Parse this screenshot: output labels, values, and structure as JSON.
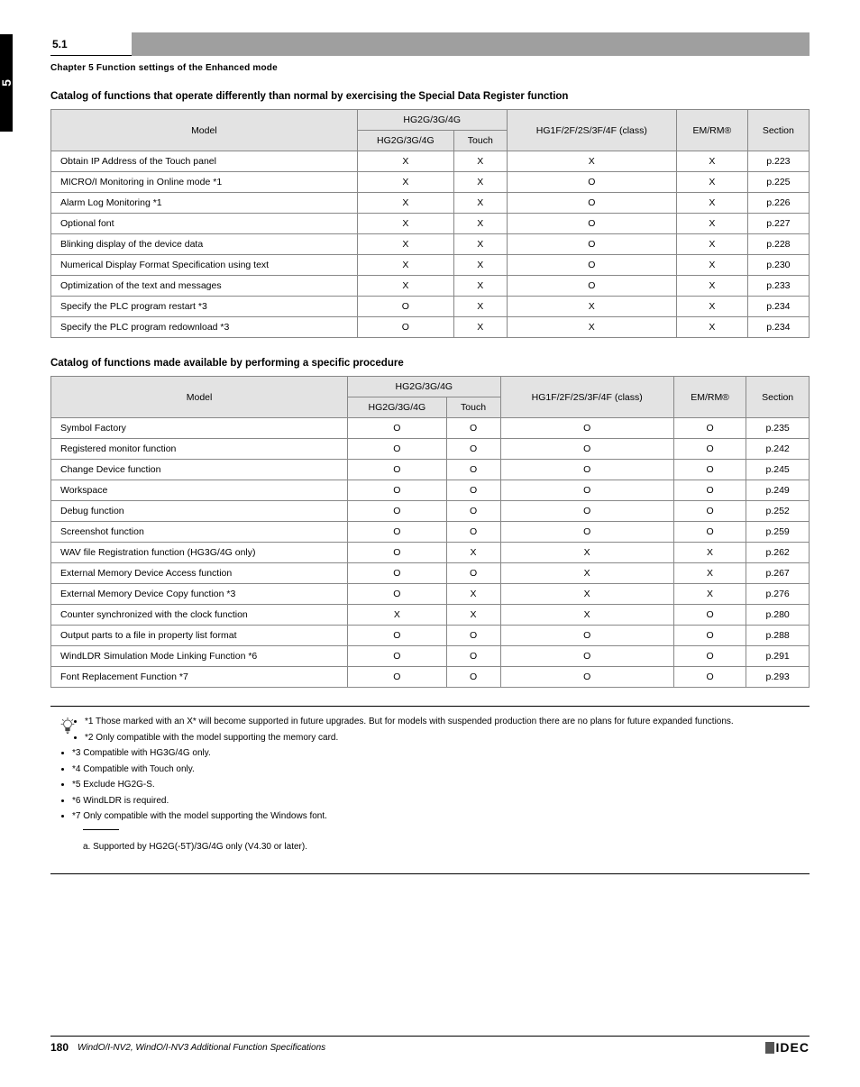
{
  "side_tab": "5",
  "header": {
    "section_no": "5.1",
    "chapter_line": "Chapter 5 Function settings of the Enhanced mode"
  },
  "table1": {
    "title": "Catalog of functions that operate differently than normal by exercising the Special Data Register function",
    "headers": {
      "model": "Model",
      "hgxg": "HG2G/3G/4G",
      "touch": "Touch",
      "class": "HG1F/2F/2S/3F/4F (class)",
      "em": "EM/RM®",
      "sec": "Section"
    },
    "rows": [
      {
        "label": "Obtain IP Address of the Touch panel",
        "hgxg": "X",
        "touch": "X",
        "class": "X",
        "em": "X",
        "sec": "p.223"
      },
      {
        "label": "MICRO/I Monitoring in Online mode *1",
        "hgxg": "X",
        "touch": "X",
        "class": "O",
        "em": "X",
        "sec": "p.225"
      },
      {
        "label": "Alarm Log Monitoring *1",
        "hgxg": "X",
        "touch": "X",
        "class": "O",
        "em": "X",
        "sec": "p.226"
      },
      {
        "label": "Optional font",
        "hgxg": "X",
        "touch": "X",
        "class": "O",
        "em": "X",
        "sec": "p.227"
      },
      {
        "label": "Blinking display of the device data",
        "hgxg": "X",
        "touch": "X",
        "class": "O",
        "em": "X",
        "sec": "p.228"
      },
      {
        "label": "Numerical Display Format Specification using text",
        "hgxg": "X",
        "touch": "X",
        "class": "O",
        "em": "X",
        "sec": "p.230"
      },
      {
        "label": "Optimization of the text and messages",
        "hgxg": "X",
        "touch": "X",
        "class": "O",
        "em": "X",
        "sec": "p.233"
      },
      {
        "label": "Specify the PLC program restart *3",
        "hgxg": "O",
        "touch": "X",
        "class": "X",
        "em": "X",
        "sec": "p.234"
      },
      {
        "label": "Specify the PLC program redownload *3",
        "hgxg": "O",
        "touch": "X",
        "class": "X",
        "em": "X",
        "sec": "p.234"
      }
    ]
  },
  "table2": {
    "title": "Catalog of functions made available by performing a specific procedure",
    "headers": {
      "model": "Model",
      "hgxg": "HG2G/3G/4G",
      "touch": "Touch",
      "class": "HG1F/2F/2S/3F/4F (class)",
      "em": "EM/RM®",
      "sec": "Section"
    },
    "rows": [
      {
        "label": "Symbol Factory",
        "hgxg": "O",
        "touch": "O",
        "class": "O",
        "em": "O",
        "sec": "p.235"
      },
      {
        "label": "Registered monitor function",
        "hgxg": "O",
        "touch": "O",
        "class": "O",
        "em": "O",
        "sec": "p.242"
      },
      {
        "label": "Change Device function",
        "hgxg": "O",
        "touch": "O",
        "class": "O",
        "em": "O",
        "sec": "p.245"
      },
      {
        "label": "Workspace",
        "hgxg": "O",
        "touch": "O",
        "class": "O",
        "em": "O",
        "sec": "p.249"
      },
      {
        "label": "Debug function",
        "hgxg": "O",
        "touch": "O",
        "class": "O",
        "em": "O",
        "sec": "p.252"
      },
      {
        "label": "Screenshot function",
        "hgxg": "O",
        "touch": "O",
        "class": "O",
        "em": "O",
        "sec": "p.259"
      },
      {
        "label": "WAV file Registration function (HG3G/4G only)",
        "hgxg": "O",
        "touch": "X",
        "class": "X",
        "em": "X",
        "sec": "p.262"
      },
      {
        "label": "External Memory Device Access function",
        "hgxg": "O",
        "touch": "O",
        "class": "X",
        "em": "X",
        "sec": "p.267"
      },
      {
        "label": "External Memory Device Copy function *3",
        "hgxg": "O",
        "touch": "X",
        "class": "X",
        "em": "X",
        "sec": "p.276"
      },
      {
        "label": "Counter synchronized with the clock function",
        "hgxg": "X",
        "touch": "X",
        "class": "X",
        "em": "O",
        "sec": "p.280"
      },
      {
        "label": "Output parts to a file in property list format",
        "hgxg": "O",
        "touch": "O",
        "class": "O",
        "em": "O",
        "sec": "p.288"
      },
      {
        "label": "WindLDR Simulation Mode Linking Function *6",
        "hgxg": "O",
        "touch": "O",
        "class": "O",
        "em": "O",
        "sec": "p.291"
      },
      {
        "label": "Font Replacement Function *7",
        "hgxg": "O",
        "touch": "O",
        "class": "O",
        "em": "O",
        "sec": "p.293"
      }
    ]
  },
  "notes": {
    "items": [
      "*1 Those marked with an X* will become supported in future upgrades. But for models with suspended production there are no plans for future expanded functions.",
      "*2 Only compatible with the model supporting the memory card.",
      "*3 Compatible with HG3G/4G only.",
      "*4 Compatible with Touch only.",
      "*5 Exclude HG2G-S.",
      "*6 WindLDR is required.",
      "*7 Only compatible with the model supporting the Windows font."
    ],
    "extra_line": "a. Supported by HG2G(-5T)/3G/4G only (V4.30 or later)."
  },
  "footer": {
    "page": "180",
    "title": "WindO/I-NV2, WindO/I-NV3 Additional Function Specifications"
  }
}
